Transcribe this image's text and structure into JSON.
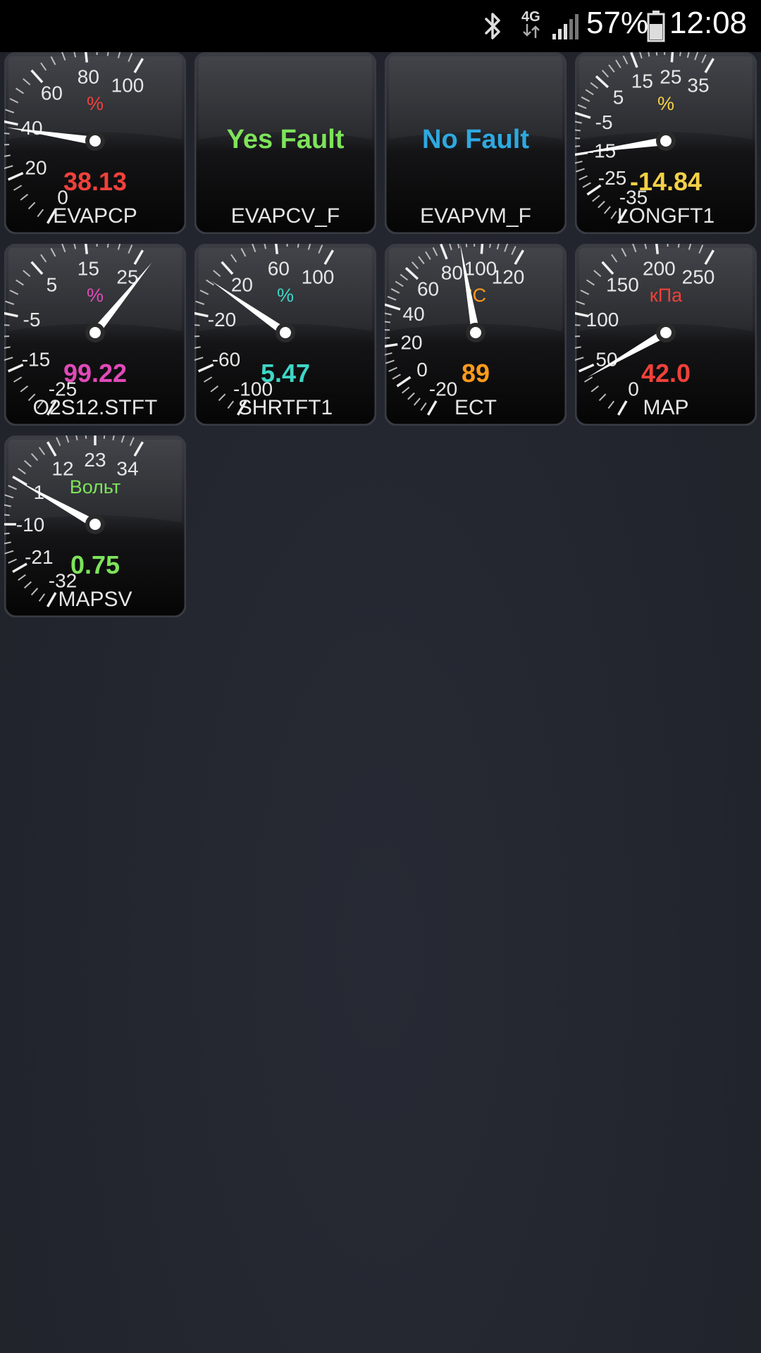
{
  "status_bar": {
    "network_label": "4G",
    "battery_percent": "57%",
    "time": "12:08",
    "icons": [
      "bluetooth-icon",
      "network-4g-icon",
      "signal-icon",
      "battery-icon"
    ]
  },
  "gauges": [
    {
      "name": "EVAPCP",
      "type": "dial",
      "unit": "%",
      "value": "38.13",
      "needle": 38.13,
      "min": 0,
      "max": 100,
      "ticks": [
        "0",
        "20",
        "40",
        "60",
        "80",
        "100"
      ],
      "color": "#f0413a"
    },
    {
      "name": "EVAPCV_F",
      "type": "text",
      "value": "Yes Fault",
      "color": "#7ee35a"
    },
    {
      "name": "EVAPVM_F",
      "type": "text",
      "value": "No Fault",
      "color": "#2ea9e0"
    },
    {
      "name": "LONGFT1",
      "type": "dial",
      "unit": "%",
      "value": "-14.84",
      "needle": -14.84,
      "min": -35,
      "max": 35,
      "ticks": [
        "-35",
        "-25",
        "-15",
        "-5",
        "5",
        "15",
        "25",
        "35"
      ],
      "color": "#f4d046"
    },
    {
      "name": "O2S12.STFT",
      "type": "dial",
      "unit": "%",
      "value": "99.22",
      "needle": 99.22,
      "min": -25,
      "max": 25,
      "ticks": [
        "-25",
        "-15",
        "-5",
        "5",
        "15",
        "25"
      ],
      "color": "#e04ab8"
    },
    {
      "name": "SHRTFT1",
      "type": "dial",
      "unit": "%",
      "value": "5.47",
      "needle": 5.47,
      "min": -100,
      "max": 100,
      "ticks": [
        "-100",
        "-60",
        "-20",
        "20",
        "60",
        "100"
      ],
      "color": "#3fd6c6"
    },
    {
      "name": "ECT",
      "type": "dial",
      "unit": "°C",
      "value": "89",
      "needle": 89,
      "min": -20,
      "max": 120,
      "ticks": [
        "-20",
        "0",
        "20",
        "40",
        "60",
        "80",
        "100",
        "120"
      ],
      "color": "#ff9a1a"
    },
    {
      "name": "MAP",
      "type": "dial",
      "unit": "кПа",
      "value": "42.0",
      "needle": 42.0,
      "min": 0,
      "max": 250,
      "ticks": [
        "0",
        "50",
        "100",
        "150",
        "200",
        "250"
      ],
      "color": "#f0413a"
    },
    {
      "name": "MAPSV",
      "type": "dial",
      "unit": "Вольт",
      "value": "0.75",
      "needle": 0.75,
      "min": -32,
      "max": 34,
      "ticks": [
        "-32",
        "-21",
        "-10",
        "1",
        "12",
        "23",
        "34"
      ],
      "color": "#7ee35a"
    }
  ]
}
